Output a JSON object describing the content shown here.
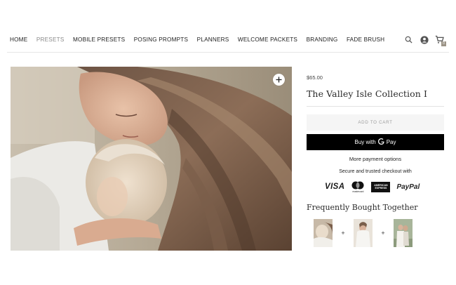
{
  "nav": {
    "items": [
      {
        "label": "HOME",
        "muted": false
      },
      {
        "label": "PRESETS",
        "muted": true
      },
      {
        "label": "MOBILE PRESETS",
        "muted": false
      },
      {
        "label": "POSING PROMPTS",
        "muted": false
      },
      {
        "label": "PLANNERS",
        "muted": false
      },
      {
        "label": "WELCOME PACKETS",
        "muted": false
      },
      {
        "label": "BRANDING",
        "muted": false
      },
      {
        "label": "FADE BRUSH",
        "muted": false
      }
    ],
    "icons": [
      "search-icon",
      "account-icon",
      "cart-icon"
    ],
    "cart_count": "0"
  },
  "product": {
    "price": "$65.00",
    "title": "The Valley Isle Collection I",
    "add_to_cart": "ADD TO CART",
    "buy_with": "Buy with",
    "gpay_label": "Pay",
    "more_payment": "More payment options",
    "secure_text": "Secure and trusted checkout with",
    "cards": {
      "visa": "VISA",
      "mastercard": "mastercard",
      "amex_line1": "AMERICAN",
      "amex_line2": "EXPRESS",
      "paypal": "PayPal"
    },
    "fbt_title": "Frequently Bought Together",
    "fbt_plus": "+"
  },
  "colors": {
    "accent_black": "#000000",
    "muted_nav": "#8a8a8a",
    "add_cart_bg": "#f5f5f5"
  }
}
